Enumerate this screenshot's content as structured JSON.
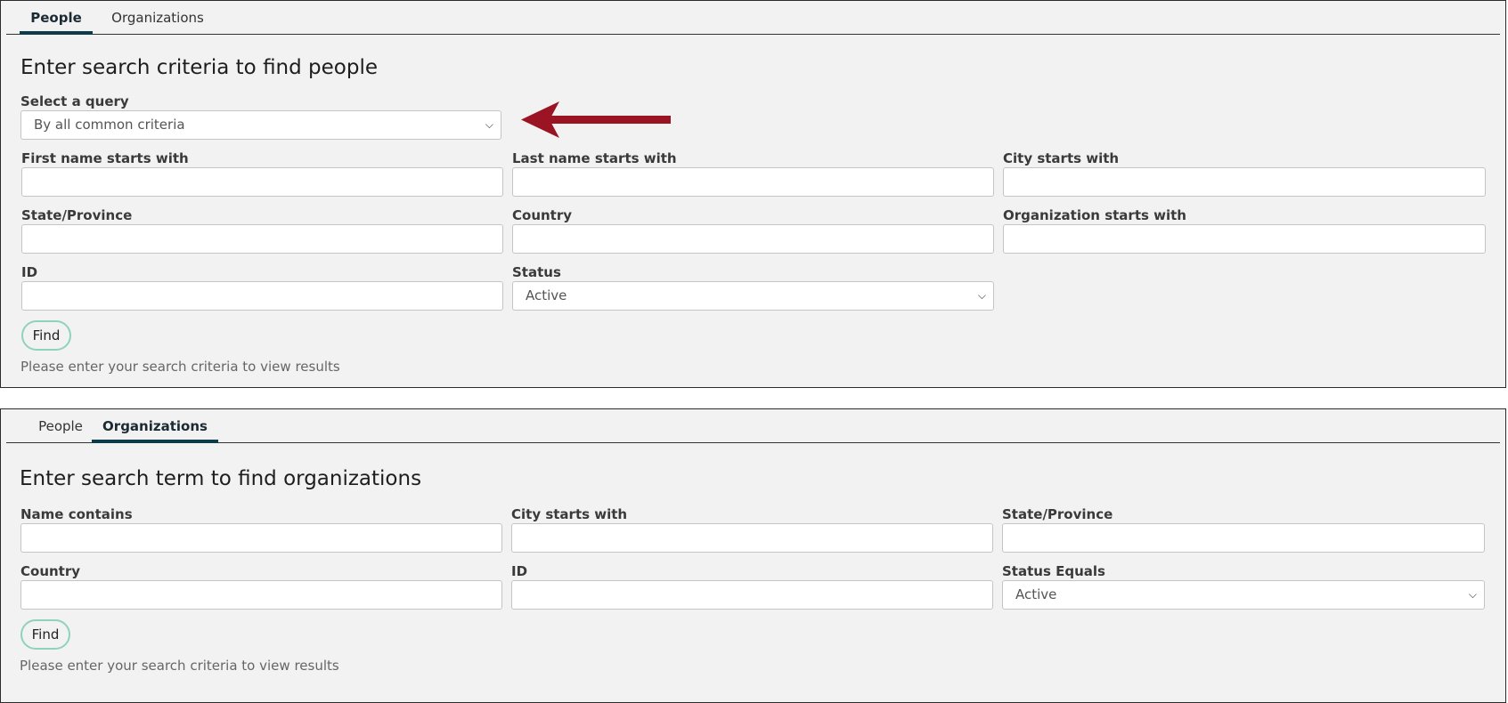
{
  "people": {
    "tabs": [
      {
        "label": "People",
        "active": true
      },
      {
        "label": "Organizations",
        "active": false
      }
    ],
    "heading": "Enter search criteria to find people",
    "query": {
      "label": "Select a query",
      "value": "By all common criteria"
    },
    "fields": {
      "first_name": "First name starts with",
      "last_name": "Last name starts with",
      "city": "City starts with",
      "state": "State/Province",
      "country": "Country",
      "organization": "Organization starts with",
      "id": "ID",
      "status": "Status"
    },
    "status_value": "Active",
    "find_label": "Find",
    "hint": "Please enter your search criteria to view results"
  },
  "organizations": {
    "tabs": [
      {
        "label": "People",
        "active": false
      },
      {
        "label": "Organizations",
        "active": true
      }
    ],
    "heading": "Enter search term to find organizations",
    "fields": {
      "name": "Name contains",
      "city": "City starts with",
      "state": "State/Province",
      "country": "Country",
      "id": "ID",
      "status": "Status Equals"
    },
    "status_value": "Active",
    "find_label": "Find",
    "hint": "Please enter your search criteria to view results"
  },
  "colors": {
    "accent": "#0e3b4a",
    "find_border": "#8fd3bb",
    "arrow": "#9a1424"
  },
  "icons": {
    "dropdown": "chevron-down-icon",
    "pointer": "arrow-left-icon"
  }
}
